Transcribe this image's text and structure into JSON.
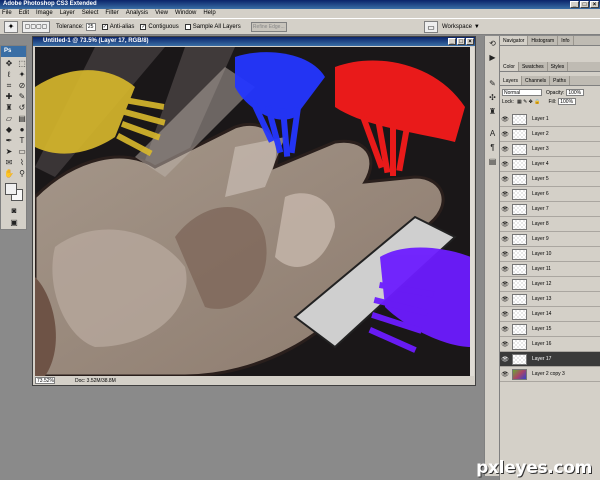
{
  "app": {
    "title": "Adobe Photoshop CS3 Extended"
  },
  "menu": [
    "File",
    "Edit",
    "Image",
    "Layer",
    "Select",
    "Filter",
    "Analysis",
    "View",
    "Window",
    "Help"
  ],
  "options": {
    "tolerance_label": "Tolerance:",
    "tolerance_value": "25",
    "antialias_label": "Anti-alias",
    "contiguous_label": "Contiguous",
    "sample_all_label": "Sample All Layers",
    "refine_edge_label": "Refine Edge...",
    "workspace_label": "Workspace"
  },
  "toolbox": {
    "logo": "Ps"
  },
  "document": {
    "title": "Untitled-1 @ 73.5% (Layer 17, RGB/8)",
    "zoom": "73.52%",
    "doc_size": "Doc: 3.52M/38.8M"
  },
  "panels": {
    "top_tabs": [
      "Navigator",
      "Histogram",
      "Info"
    ],
    "color_tabs": [
      "Color",
      "Swatches",
      "Styles"
    ],
    "layer_tabs": [
      "Layers",
      "Channels",
      "Paths"
    ],
    "blend_mode": "Normal",
    "opacity_label": "Opacity:",
    "opacity_value": "100%",
    "lock_label": "Lock:",
    "fill_label": "Fill:",
    "fill_value": "100%"
  },
  "layers": [
    {
      "name": "Layer 1"
    },
    {
      "name": "Layer 2"
    },
    {
      "name": "Layer 3"
    },
    {
      "name": "Layer 4"
    },
    {
      "name": "Layer 5"
    },
    {
      "name": "Layer 6"
    },
    {
      "name": "Layer 7"
    },
    {
      "name": "Layer 8"
    },
    {
      "name": "Layer 9"
    },
    {
      "name": "Layer 10"
    },
    {
      "name": "Layer 11"
    },
    {
      "name": "Layer 12"
    },
    {
      "name": "Layer 13"
    },
    {
      "name": "Layer 14"
    },
    {
      "name": "Layer 15"
    },
    {
      "name": "Layer 16"
    },
    {
      "name": "Layer 17",
      "selected": true
    },
    {
      "name": "Layer 2 copy 3",
      "image": true
    }
  ],
  "watermark": "pxleyes.com"
}
